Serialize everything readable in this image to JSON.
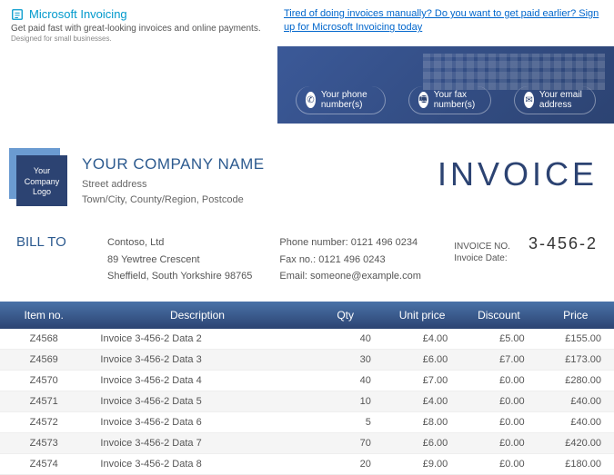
{
  "brand": {
    "name": "Microsoft Invoicing",
    "tag": "Get paid fast with great-looking invoices and online payments.",
    "sub": "Designed for small businesses."
  },
  "promo": "Tired of doing invoices manually? Do you want to get paid earlier? Sign up for Microsoft Invoicing today",
  "contacts": {
    "phone": "Your phone number(s)",
    "fax": "Your fax number(s)",
    "email": "Your email address"
  },
  "company": {
    "logo": "Your Company Logo",
    "name": "YOUR COMPANY NAME",
    "street": "Street address",
    "city": "Town/City, County/Region, Postcode"
  },
  "invoice_title": "INVOICE",
  "billto_label": "BILL TO",
  "billto": {
    "l1": "Contoso, Ltd",
    "l2": "89 Yewtree Crescent",
    "l3": "Sheffield, South Yorkshire 98765"
  },
  "billcontact": {
    "l1": "Phone number: 0121 496 0234",
    "l2": "Fax no.: 0121 496 0243",
    "l3": "Email: someone@example.com"
  },
  "meta": {
    "no_lbl": "INVOICE NO.",
    "no_val": "3-456-2",
    "date_lbl": "Invoice Date:"
  },
  "th": {
    "item": "Item no.",
    "desc": "Description",
    "qty": "Qty",
    "unit": "Unit price",
    "disc": "Discount",
    "price": "Price"
  },
  "rows": [
    {
      "item": "Z4568",
      "desc": "Invoice 3-456-2 Data 2",
      "qty": "40",
      "unit": "£4.00",
      "disc": "£5.00",
      "price": "£155.00"
    },
    {
      "item": "Z4569",
      "desc": "Invoice 3-456-2 Data 3",
      "qty": "30",
      "unit": "£6.00",
      "disc": "£7.00",
      "price": "£173.00"
    },
    {
      "item": "Z4570",
      "desc": "Invoice 3-456-2 Data 4",
      "qty": "40",
      "unit": "£7.00",
      "disc": "£0.00",
      "price": "£280.00"
    },
    {
      "item": "Z4571",
      "desc": "Invoice 3-456-2 Data 5",
      "qty": "10",
      "unit": "£4.00",
      "disc": "£0.00",
      "price": "£40.00"
    },
    {
      "item": "Z4572",
      "desc": "Invoice 3-456-2 Data 6",
      "qty": "5",
      "unit": "£8.00",
      "disc": "£0.00",
      "price": "£40.00"
    },
    {
      "item": "Z4573",
      "desc": "Invoice 3-456-2 Data 7",
      "qty": "70",
      "unit": "£6.00",
      "disc": "£0.00",
      "price": "£420.00"
    },
    {
      "item": "Z4574",
      "desc": "Invoice 3-456-2 Data 8",
      "qty": "20",
      "unit": "£9.00",
      "disc": "£0.00",
      "price": "£180.00"
    }
  ]
}
